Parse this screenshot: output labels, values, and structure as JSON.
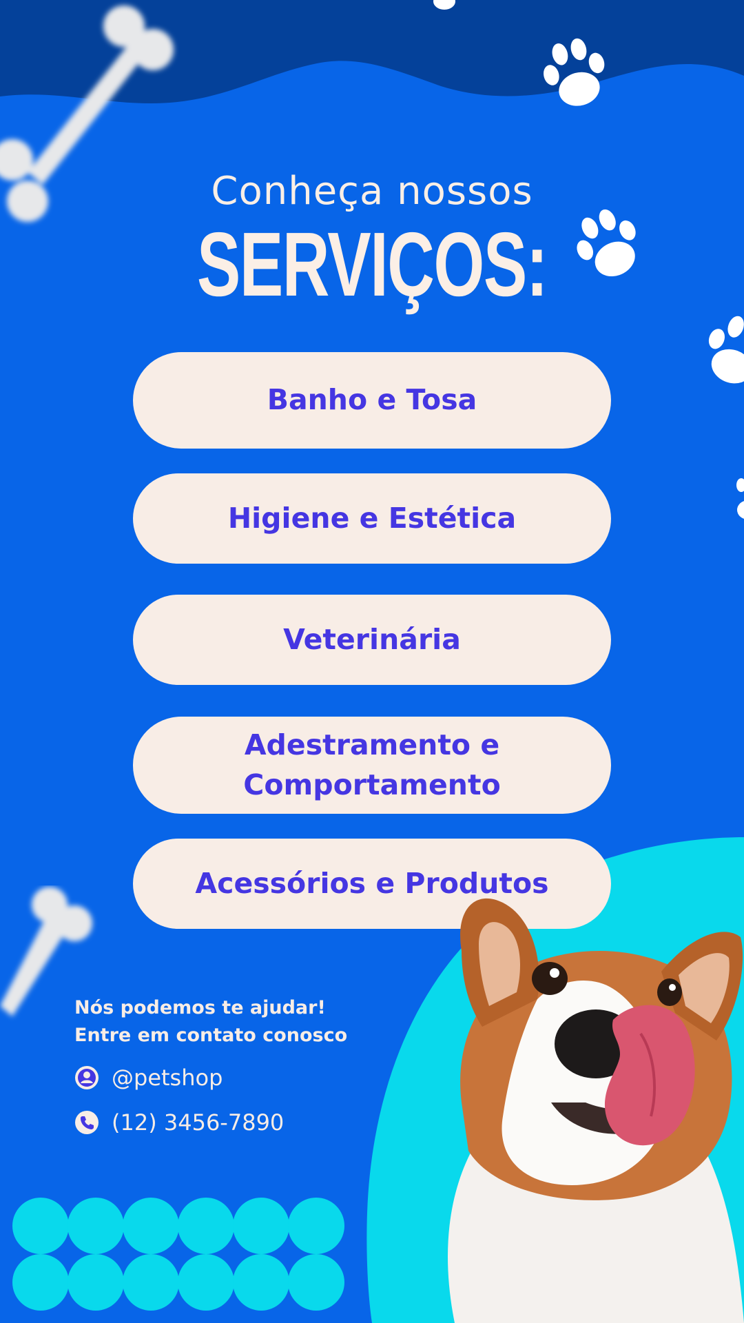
{
  "header": {
    "line1": "Conheça nossos",
    "line2": "SERVIÇOS:"
  },
  "services": [
    {
      "label": "Banho e Tosa"
    },
    {
      "label": "Higiene e Estética"
    },
    {
      "label": "Veterinária"
    },
    {
      "label": "Adestramento e Comportamento"
    },
    {
      "label": "Acessórios e Produtos"
    }
  ],
  "contact": {
    "line1": "Nós podemos te ajudar!",
    "line2": "Entre em contato conosco",
    "handle": "@petshop",
    "phone": "(12) 3456-7890",
    "handle_icon": "user-circle-icon",
    "phone_icon": "phone-icon"
  },
  "colors": {
    "background": "#0865e8",
    "top_wave": "#04419a",
    "accent_cyan": "#09d9ec",
    "pill": "#f8ede6",
    "pill_text": "#4536e2",
    "light_text": "#f8ede6"
  },
  "decorations": {
    "bones": [
      "bone-icon",
      "bone-icon"
    ],
    "paws": [
      "paw-icon",
      "paw-icon",
      "paw-icon",
      "paw-icon"
    ],
    "photo": "corgi-dog-image"
  }
}
